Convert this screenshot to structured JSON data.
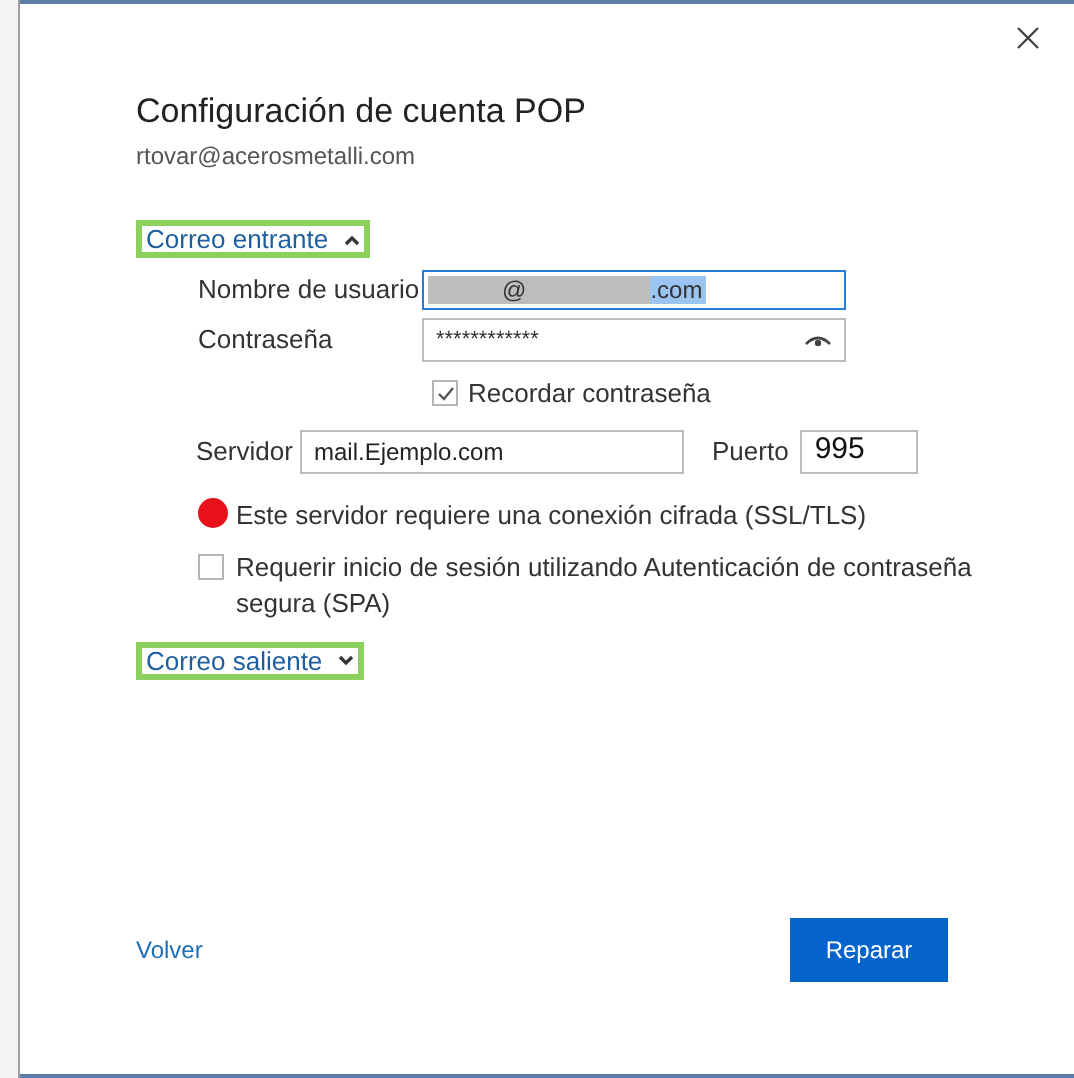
{
  "title": "Configuración de cuenta POP",
  "account": "rtovar@acerosmetalli.com",
  "incoming": {
    "label": "Correo entrante",
    "expanded": true
  },
  "username": {
    "label": "Nombre de usuario",
    "value_parts": [
      "@",
      ".com"
    ]
  },
  "password": {
    "label": "Contraseña",
    "value": "************"
  },
  "remember": {
    "label": "Recordar contraseña",
    "checked": true
  },
  "server": {
    "label": "Servidor",
    "value": "mail.Ejemplo.com"
  },
  "port": {
    "label": "Puerto",
    "value": "995"
  },
  "options": [
    {
      "kind": "marked",
      "label": "Este servidor requiere una conexión cifrada (SSL/TLS)"
    },
    {
      "kind": "checkbox",
      "label": "Requerir inicio de sesión utilizando Autenticación de contraseña segura (SPA)",
      "checked": false
    }
  ],
  "outgoing": {
    "label": "Correo saliente",
    "expanded": false
  },
  "back": "Volver",
  "repair": "Reparar"
}
